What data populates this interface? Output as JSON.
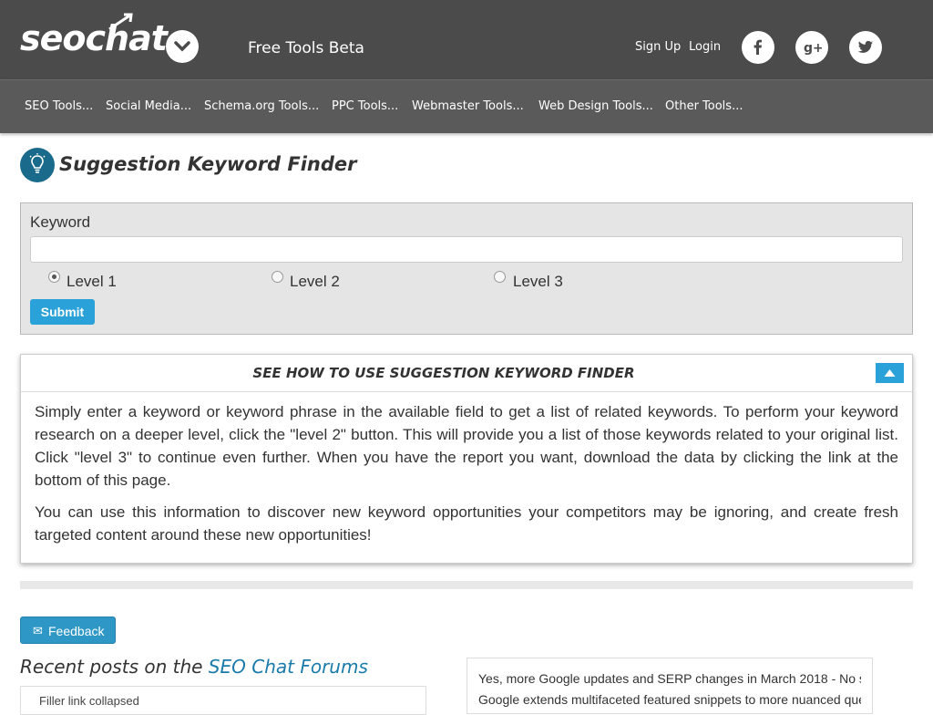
{
  "header": {
    "logo_text": "seochat",
    "free_tools": "Free Tools Beta",
    "sign_up": "Sign Up",
    "login": "Login",
    "social": [
      "facebook-icon",
      "google-plus-icon",
      "twitter-icon"
    ]
  },
  "nav": {
    "items": [
      "SEO Tools...",
      "Social Media...",
      "Schema.org Tools...",
      "PPC Tools...",
      "Webmaster Tools...",
      "Web Design Tools...",
      "Other Tools..."
    ]
  },
  "page": {
    "title": "Suggestion Keyword Finder",
    "icon": "lightbulb-icon"
  },
  "form": {
    "keyword_label": "Keyword",
    "keyword_value": "",
    "levels": [
      "Level 1",
      "Level 2",
      "Level 3"
    ],
    "selected_level": "Level 1",
    "submit_label": "Submit"
  },
  "howto": {
    "title": "SEE HOW TO USE SUGGESTION KEYWORD FINDER",
    "paragraph_1": "Simply enter a keyword or keyword phrase in the available field to get a list of related keywords.  To perform your keyword research on a deeper level, click the \"level 2\" button.  This will provide you a list of those keywords related to your original list.  Click \"level 3\" to continue even further.  When you have the report you want, download the data by clicking the link at the bottom of this page.",
    "paragraph_2": "You can use this information to discover new keyword opportunities your competitors may be ignoring, and create fresh targeted content around these new opportunities!"
  },
  "feedback": {
    "label": "Feedback",
    "icon": "envelope-icon"
  },
  "recent": {
    "prefix": "Recent posts on the ",
    "link": "SEO Chat Forums",
    "first_item": "Filler link collapsed"
  },
  "news": {
    "items": [
      "Yes, more Google updates and SERP changes in March 2018 - No s",
      "Google extends multifaceted featured snippets to more nuanced que"
    ]
  },
  "colors": {
    "topbar": "#4b4b4b",
    "navbar": "#5a5a5a",
    "accent": "#2aa1d8",
    "link": "#1a7bab"
  }
}
